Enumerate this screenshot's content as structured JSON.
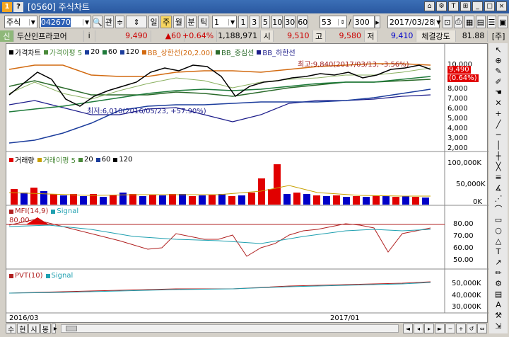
{
  "window": {
    "title": "[0560] 주식차트"
  },
  "toolbar": {
    "market": "주식",
    "code": "042670",
    "buttons_small": [
      "관"
    ],
    "periods": [
      "일",
      "주",
      "월",
      "분",
      "틱"
    ],
    "minute_options": [
      "1",
      "3",
      "5",
      "10",
      "30",
      "60"
    ],
    "count": "53",
    "total": "300",
    "date": "2017/03/28"
  },
  "quote": {
    "name": "두산인프라코어",
    "price": "9,490",
    "change": "▲60",
    "rate": "+0.64%",
    "volume": "1,188,971",
    "open_label": "시",
    "open": "9,510",
    "high_label": "고",
    "high": "9,580",
    "low_label": "저",
    "low": "9,410",
    "strength_label": "체결강도",
    "strength": "81.88",
    "unit": "[주]"
  },
  "price_panel": {
    "legend": [
      "가격차트",
      "가격이평 5",
      "20",
      "60",
      "120",
      "BB_상한선(20,2.00)",
      "BB_중심선",
      "BB_하한선"
    ],
    "high_note": "최고:9,840(2017/03/13, -3.56%)",
    "low_note": "최저:6,010(2016/05/23, +57.90%)",
    "price_tag": "9,490",
    "rate_tag": "(0.64%)",
    "axis": [
      "10,000",
      "9,000",
      "8,000",
      "7,000",
      "6,000",
      "5,000",
      "4,000",
      "3,000",
      "2,000"
    ]
  },
  "volume_panel": {
    "legend": [
      "거래량",
      "거래이평 5",
      "20",
      "60",
      "120"
    ],
    "axis": [
      "100,000K",
      "50,000K",
      "0K"
    ]
  },
  "mfi_panel": {
    "legend": [
      "MFI(14,9)",
      "Signal"
    ],
    "level": "80.00",
    "axis": [
      "80.00",
      "70.00",
      "60.00",
      "50.00"
    ]
  },
  "pvt_panel": {
    "legend": [
      "PVT(10)",
      "Signal"
    ],
    "axis": [
      "50,000K",
      "40,000K",
      "30,000K"
    ]
  },
  "x_axis": [
    "2016/03",
    "2017/01"
  ],
  "bottom": {
    "buttons": [
      "수",
      "현",
      "시",
      "봉"
    ]
  },
  "colors": {
    "up": "#e10000",
    "down": "#0000c8",
    "ma5": "#000000",
    "ma20": "#4a8a3a",
    "ma60": "#1e7a3a",
    "ma120": "#1c3d9c",
    "bb_up": "#d26a10",
    "bb_mid": "#2a6a2a",
    "bb_low": "#1c1c8a",
    "signal": "#20a0b0",
    "mfi": "#b02020"
  }
}
